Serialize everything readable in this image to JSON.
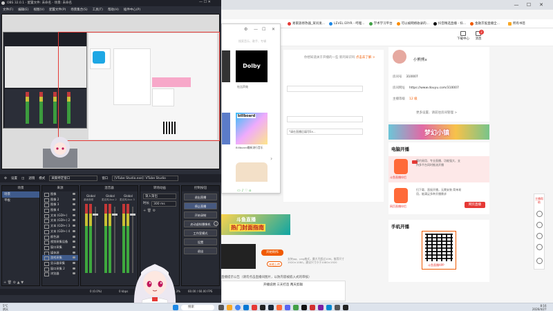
{
  "obs": {
    "title": "OBS 32.0.1 - 配置文件: 未命名 - 场景: 未命名",
    "menu": [
      "文件(F)",
      "编辑(E)",
      "视图(V)",
      "配置文件(P)",
      "场景集合(S)",
      "工具(T)",
      "帮助(H)",
      "插件中心(P)"
    ],
    "toolbar": {
      "settings_label": "设置",
      "filters_label": "滤镜",
      "mode_label": "模式",
      "mode_value": "采集特定窗口",
      "window_label": "窗口",
      "window_value": "[VTube Studio.exe]: VTube Studio"
    },
    "docks": {
      "scenes_title": "场景",
      "sources_title": "来源",
      "mixer_title": "混音器",
      "transitions_title": "转场动画",
      "controls_title": "控制按钮"
    },
    "scenes": [
      "场景",
      "平板"
    ],
    "sources": [
      "图像",
      "图像 2",
      "图像 3",
      "图像 4",
      "文本 (GDI+)",
      "文本 (GDI+) 2",
      "文本 (GDI+) 3",
      "文本 (GDI+) 4",
      "颜色源",
      "视频采集设备",
      "窗口采集",
      "媒体源",
      "游戏采集",
      "显示器采集",
      "窗口采集 2",
      "浏览器"
    ],
    "mixer": [
      {
        "name": "Global",
        "device": "桌面音频"
      },
      {
        "name": "Global",
        "device": "麦克风/Aux 2"
      },
      {
        "name": "Global",
        "device": "麦克风/Aux 3"
      }
    ],
    "transitions": {
      "type": "渐入渐出",
      "duration_label": "时长",
      "duration_value": "300 ms"
    },
    "controls": [
      "退出直播",
      "停止直播",
      "开始录制",
      "启动虚拟摄像机",
      "工作室模式",
      "设置",
      "退出"
    ],
    "status": {
      "dropped": "0 (0.0%)",
      "bitrate": "0 kbps",
      "cpu": "CPU: 2.3%",
      "fps": "60.00 / 60.00 FPS",
      "time": "00:00:00"
    }
  },
  "bookmarks": [
    "易家族修改器_某问发...",
    "LEVEL ERYR - 哔哩...",
    "学术学习平台",
    "可以被网络收录的...",
    "抖音精选直播 - 抖...",
    "金融京股直播全..."
  ],
  "bookmark_colors": [
    "#e53935",
    "#1e88e5",
    "#43a047",
    "#fb8c00",
    "#111111",
    "#f05a00"
  ],
  "bookmark_more": "所有书签",
  "header": {
    "download_label": "下载中心",
    "message_label": "消息",
    "message_count": "2"
  },
  "main": {
    "tip": "你想知道关于开播的一些 新的知识吗",
    "tip_link": "点击去了解 >",
    "field_note": "*请在直播后填写Ex...",
    "notice": "直播提示公告（请勿点击直播间图片，以防内容被嵌入式的审核）",
    "input_text": "开播说明 三天打造 两天剪辑"
  },
  "profile": {
    "name": "小熊熊x",
    "rows": [
      {
        "label": "房间号",
        "value": "310007"
      },
      {
        "label": "房间网址",
        "value": "https://www.douyu.com/310007"
      },
      {
        "label": "主播等级",
        "value": "12 级"
      }
    ],
    "more": "更多设置、请前往房间管理 >"
  },
  "banner_text": "梦幻小镇",
  "live": {
    "title": "电脑开播",
    "cards": [
      {
        "name": "斗鱼直播伴侣",
        "desc": "简约易用、专业直播、功能强大、支持多平台同时推流开播"
      },
      {
        "name": "网页直播伴侣",
        "desc": "扫下载、直接开播，无需安装 简单易用，能满足多种开播需求"
      }
    ],
    "web_btn": "网页直播"
  },
  "mobile": {
    "title": "手机开播",
    "qr_label": "斗鱼直播APP"
  },
  "rail_label": "主播帮助",
  "popup": {
    "search": "搜索音乐、歌手、专辑",
    "dolby": "Dolby",
    "dolby_label": "杜比声效",
    "billboard": "billboard",
    "bb_label": "Billboard最新流行音乐"
  },
  "promo": {
    "title": "斗鱼直播",
    "subtitle": "热门封面指南"
  },
  "create": {
    "btn_create": "开始制作",
    "btn_upload": "本地上传",
    "hint": "支持jpg、png格式，最大不超过10M，推荐尺寸1920×1080，建议尺寸小于1080×1920"
  },
  "taskbar": {
    "search": "搜索",
    "weather_temp": "5°C",
    "weather_desc": "阴天",
    "time": "8:16",
    "date": "2026/4/27"
  }
}
